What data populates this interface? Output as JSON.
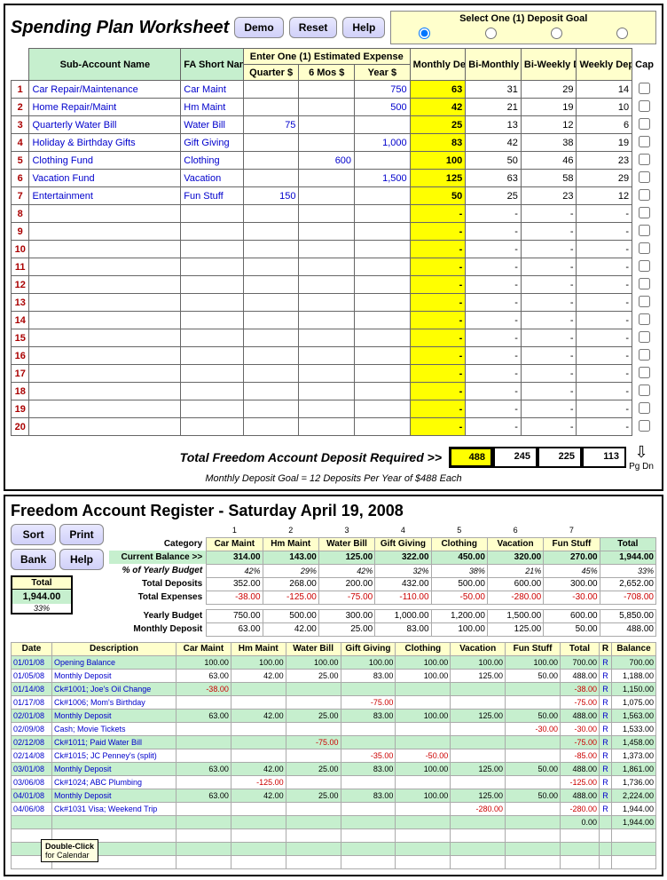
{
  "worksheet": {
    "title": "Spending Plan Worksheet",
    "buttons": {
      "demo": "Demo",
      "reset": "Reset",
      "help": "Help"
    },
    "depositGoalTitle": "Select One (1) Deposit Goal",
    "headers": {
      "subAccount": "Sub-Account Name",
      "faShort": "FA Short Name",
      "estExpense": "Enter One (1) Estimated Expense",
      "quarter": "Quarter $",
      "sixmos": "6 Mos $",
      "year": "Year $",
      "monthly": "Monthly Deposit $",
      "bimonthly": "Bi-Monthly Deposit $",
      "biweekly": "Bi-Weekly Deposit $",
      "weekly": "Weekly Deposit $",
      "cap": "Cap"
    },
    "rows": [
      {
        "n": "1",
        "name": "Car Repair/Maintenance",
        "short": "Car Maint",
        "q": "",
        "m6": "",
        "yr": "750",
        "mo": "63",
        "bm": "31",
        "bw": "29",
        "wk": "14"
      },
      {
        "n": "2",
        "name": "Home Repair/Maint",
        "short": "Hm Maint",
        "q": "",
        "m6": "",
        "yr": "500",
        "mo": "42",
        "bm": "21",
        "bw": "19",
        "wk": "10"
      },
      {
        "n": "3",
        "name": "Quarterly Water Bill",
        "short": "Water Bill",
        "q": "75",
        "m6": "",
        "yr": "",
        "mo": "25",
        "bm": "13",
        "bw": "12",
        "wk": "6"
      },
      {
        "n": "4",
        "name": "Holiday & Birthday Gifts",
        "short": "Gift Giving",
        "q": "",
        "m6": "",
        "yr": "1,000",
        "mo": "83",
        "bm": "42",
        "bw": "38",
        "wk": "19"
      },
      {
        "n": "5",
        "name": "Clothing Fund",
        "short": "Clothing",
        "q": "",
        "m6": "600",
        "yr": "",
        "mo": "100",
        "bm": "50",
        "bw": "46",
        "wk": "23"
      },
      {
        "n": "6",
        "name": "Vacation Fund",
        "short": "Vacation",
        "q": "",
        "m6": "",
        "yr": "1,500",
        "mo": "125",
        "bm": "63",
        "bw": "58",
        "wk": "29"
      },
      {
        "n": "7",
        "name": "Entertainment",
        "short": "Fun Stuff",
        "q": "150",
        "m6": "",
        "yr": "",
        "mo": "50",
        "bm": "25",
        "bw": "23",
        "wk": "12"
      },
      {
        "n": "8"
      },
      {
        "n": "9"
      },
      {
        "n": "10"
      },
      {
        "n": "11"
      },
      {
        "n": "12"
      },
      {
        "n": "13"
      },
      {
        "n": "14"
      },
      {
        "n": "15"
      },
      {
        "n": "16"
      },
      {
        "n": "17"
      },
      {
        "n": "18"
      },
      {
        "n": "19"
      },
      {
        "n": "20"
      }
    ],
    "totalLabel": "Total Freedom Account Deposit Required  >>",
    "totals": {
      "mo": "488",
      "bm": "245",
      "bw": "225",
      "wk": "113"
    },
    "subnote": "Monthly Deposit Goal = 12 Deposits Per Year of $488 Each",
    "pgdn": "Pg Dn"
  },
  "register": {
    "title": "Freedom Account Register - Saturday April 19, 2008",
    "buttons": {
      "sort": "Sort",
      "print": "Print",
      "bank": "Bank",
      "help": "Help"
    },
    "labels": {
      "category": "Category",
      "curbal": "Current Balance >>",
      "pct": "% of Yearly Budget",
      "totdep": "Total Deposits",
      "totexp": "Total Expenses",
      "yrbud": "Yearly Budget",
      "modep": "Monthly Deposit",
      "total": "Total"
    },
    "totbox": {
      "label": "Total",
      "value": "1,944.00",
      "pct": "33%"
    },
    "catnums": [
      "1",
      "2",
      "3",
      "4",
      "5",
      "6",
      "7",
      ""
    ],
    "cats": [
      "Car Maint",
      "Hm Maint",
      "Water Bill",
      "Gift Giving",
      "Clothing",
      "Vacation",
      "Fun Stuff",
      "Total"
    ],
    "balance": [
      "314.00",
      "143.00",
      "125.00",
      "322.00",
      "450.00",
      "320.00",
      "270.00",
      "1,944.00"
    ],
    "pcts": [
      "42%",
      "29%",
      "42%",
      "32%",
      "38%",
      "21%",
      "45%",
      "33%"
    ],
    "deposits": [
      "352.00",
      "268.00",
      "200.00",
      "432.00",
      "500.00",
      "600.00",
      "300.00",
      "2,652.00"
    ],
    "expenses": [
      "-38.00",
      "-125.00",
      "-75.00",
      "-110.00",
      "-50.00",
      "-280.00",
      "-30.00",
      "-708.00"
    ],
    "yrbudget": [
      "750.00",
      "500.00",
      "300.00",
      "1,000.00",
      "1,200.00",
      "1,500.00",
      "600.00",
      "5,850.00"
    ],
    "modeposit": [
      "63.00",
      "42.00",
      "25.00",
      "83.00",
      "100.00",
      "125.00",
      "50.00",
      "488.00"
    ],
    "ledgerHeaders": {
      "date": "Date",
      "desc": "Description",
      "r": "R",
      "bal": "Balance"
    },
    "ledger": [
      {
        "date": "01/01/08",
        "desc": "Opening Balance",
        "v": [
          "100.00",
          "100.00",
          "100.00",
          "100.00",
          "100.00",
          "100.00",
          "100.00"
        ],
        "tot": "700.00",
        "r": "R",
        "bal": "700.00",
        "g": true
      },
      {
        "date": "01/05/08",
        "desc": "Monthly Deposit",
        "v": [
          "63.00",
          "42.00",
          "25.00",
          "83.00",
          "100.00",
          "125.00",
          "50.00"
        ],
        "tot": "488.00",
        "r": "R",
        "bal": "1,188.00"
      },
      {
        "date": "01/14/08",
        "desc": "Ck#1001; Joe's Oil Change",
        "v": [
          "-38.00",
          "",
          "",
          "",
          "",
          "",
          ""
        ],
        "tot": "-38.00",
        "r": "R",
        "bal": "1,150.00",
        "g": true
      },
      {
        "date": "01/17/08",
        "desc": "Ck#1006; Mom's Birthday",
        "v": [
          "",
          "",
          "",
          "-75.00",
          "",
          "",
          ""
        ],
        "tot": "-75.00",
        "r": "R",
        "bal": "1,075.00"
      },
      {
        "date": "02/01/08",
        "desc": "Monthly Deposit",
        "v": [
          "63.00",
          "42.00",
          "25.00",
          "83.00",
          "100.00",
          "125.00",
          "50.00"
        ],
        "tot": "488.00",
        "r": "R",
        "bal": "1,563.00",
        "g": true
      },
      {
        "date": "02/09/08",
        "desc": "Cash; Movie Tickets",
        "v": [
          "",
          "",
          "",
          "",
          "",
          "",
          "-30.00"
        ],
        "tot": "-30.00",
        "r": "R",
        "bal": "1,533.00"
      },
      {
        "date": "02/12/08",
        "desc": "Ck#1011; Paid Water Bill",
        "v": [
          "",
          "",
          "-75.00",
          "",
          "",
          "",
          ""
        ],
        "tot": "-75.00",
        "r": "R",
        "bal": "1,458.00",
        "g": true
      },
      {
        "date": "02/14/08",
        "desc": "Ck#1015; JC Penney's (split)",
        "v": [
          "",
          "",
          "",
          "-35.00",
          "-50.00",
          "",
          ""
        ],
        "tot": "-85.00",
        "r": "R",
        "bal": "1,373.00"
      },
      {
        "date": "03/01/08",
        "desc": "Monthly Deposit",
        "v": [
          "63.00",
          "42.00",
          "25.00",
          "83.00",
          "100.00",
          "125.00",
          "50.00"
        ],
        "tot": "488.00",
        "r": "R",
        "bal": "1,861.00",
        "g": true
      },
      {
        "date": "03/06/08",
        "desc": "Ck#1024; ABC Plumbing",
        "v": [
          "",
          "-125.00",
          "",
          "",
          "",
          "",
          ""
        ],
        "tot": "-125.00",
        "r": "R",
        "bal": "1,736.00"
      },
      {
        "date": "04/01/08",
        "desc": "Monthly Deposit",
        "v": [
          "63.00",
          "42.00",
          "25.00",
          "83.00",
          "100.00",
          "125.00",
          "50.00"
        ],
        "tot": "488.00",
        "r": "R",
        "bal": "2,224.00",
        "g": true
      },
      {
        "date": "04/06/08",
        "desc": "Ck#1031 Visa; Weekend Trip",
        "v": [
          "",
          "",
          "",
          "",
          "",
          "-280.00",
          ""
        ],
        "tot": "-280.00",
        "r": "R",
        "bal": "1,944.00"
      },
      {
        "date": "",
        "desc": "",
        "v": [
          "",
          "",
          "",
          "",
          "",
          "",
          ""
        ],
        "tot": "0.00",
        "r": "",
        "bal": "1,944.00",
        "g": true,
        "plain": true
      },
      {
        "date": "",
        "desc": "",
        "v": [
          "",
          "",
          "",
          "",
          "",
          "",
          ""
        ],
        "tot": "",
        "r": "",
        "bal": "",
        "g": false,
        "empty": true
      },
      {
        "date": "",
        "desc": "",
        "v": [
          "",
          "",
          "",
          "",
          "",
          "",
          ""
        ],
        "tot": "",
        "r": "",
        "bal": "",
        "g": true,
        "empty": true
      },
      {
        "date": "",
        "desc": "",
        "v": [
          "",
          "",
          "",
          "",
          "",
          "",
          ""
        ],
        "tot": "",
        "r": "",
        "bal": "",
        "g": false,
        "empty": true
      }
    ],
    "tooltip": "Double-Click for Calendar"
  }
}
